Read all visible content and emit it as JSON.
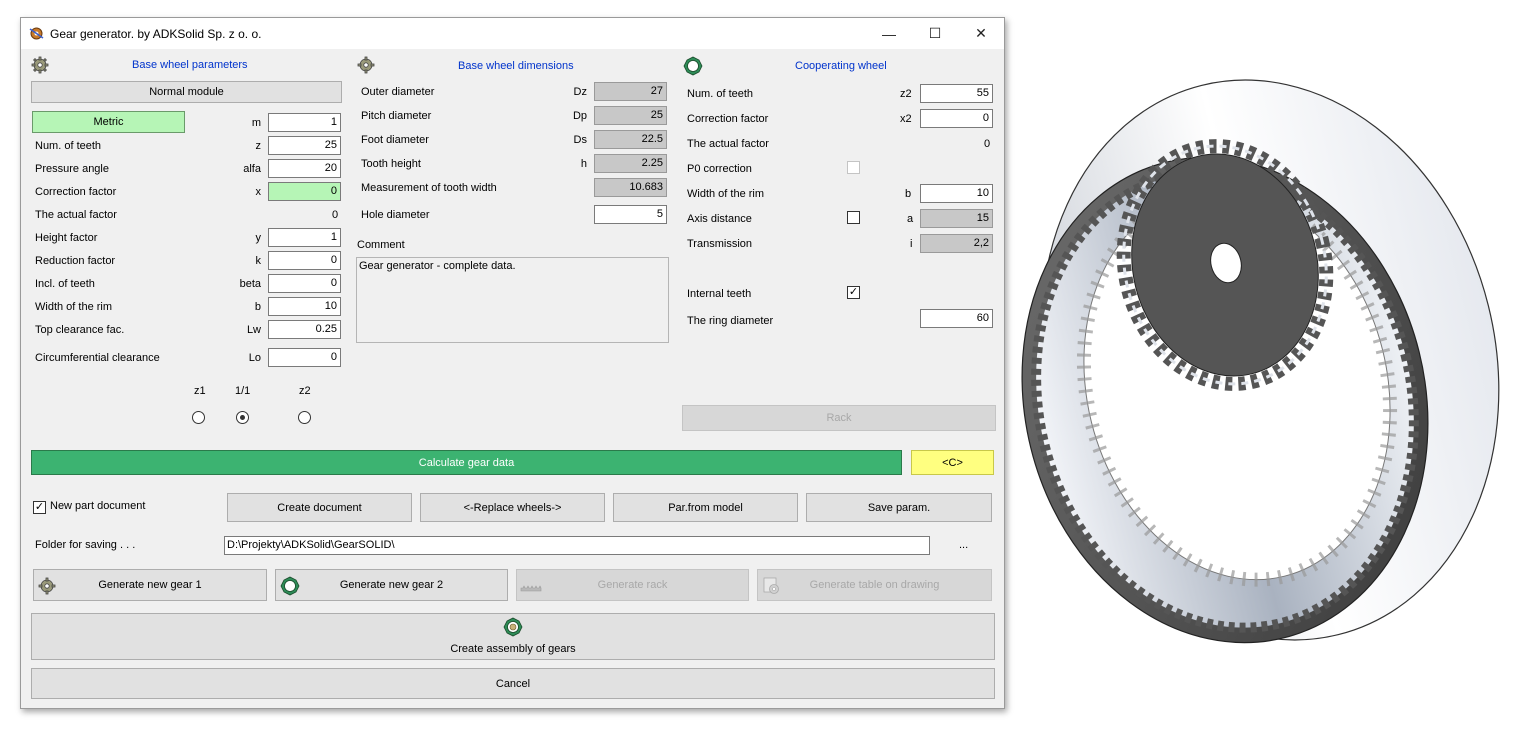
{
  "window": {
    "title": "Gear generator. by  ADKSolid Sp. z o. o.",
    "controls": {
      "minimize": "—",
      "maximize": "☐",
      "close": "✕"
    }
  },
  "base_params": {
    "header": "Base wheel parameters",
    "module_button": "Normal module",
    "metric_button": "Metric",
    "rows": [
      {
        "label": "",
        "symbol": "m",
        "value": "1"
      },
      {
        "label": "Num. of teeth",
        "symbol": "z",
        "value": "25"
      },
      {
        "label": "Pressure angle",
        "symbol": "alfa",
        "value": "20"
      },
      {
        "label": "Correction factor",
        "symbol": "x",
        "value": "0"
      },
      {
        "label": "The actual factor",
        "symbol": "",
        "value": "0"
      },
      {
        "label": "Height factor",
        "symbol": "y",
        "value": "1"
      },
      {
        "label": "Reduction factor",
        "symbol": "k",
        "value": "0"
      },
      {
        "label": "Incl. of teeth",
        "symbol": "beta",
        "value": "0"
      },
      {
        "label": "Width of the rim",
        "symbol": "b",
        "value": "10"
      },
      {
        "label": "Top clearance fac.",
        "symbol": "Lw",
        "value": "0.25"
      },
      {
        "label": "Circumferential clearance",
        "symbol": "Lo",
        "value": "0"
      }
    ],
    "ratio_options": [
      {
        "label": "z1",
        "selected": false
      },
      {
        "label": "1/1",
        "selected": true
      },
      {
        "label": "z2",
        "selected": false
      }
    ]
  },
  "dimensions": {
    "header": "Base wheel dimensions",
    "rows": [
      {
        "label": "Outer diameter",
        "symbol": "Dz",
        "value": "27"
      },
      {
        "label": "Pitch diameter",
        "symbol": "Dp",
        "value": "25"
      },
      {
        "label": "Foot diameter",
        "symbol": "Ds",
        "value": "22.5"
      },
      {
        "label": "Tooth height",
        "symbol": "h",
        "value": "2.25"
      },
      {
        "label": "Measurement of tooth width",
        "symbol": "",
        "value": "10.683"
      },
      {
        "label": "Hole diameter",
        "symbol": "",
        "value": "5"
      }
    ],
    "comment_label": "Comment",
    "comment_text": "Gear generator - complete data."
  },
  "coop": {
    "header": "Cooperating wheel",
    "teeth_label": "Num. of teeth",
    "teeth_symbol": "z2",
    "teeth_value": "55",
    "corr_label": "Correction factor",
    "corr_symbol": "x2",
    "corr_value": "0",
    "actual_label": "The actual factor",
    "actual_value": "0",
    "p0_label": "P0 correction",
    "rim_label": "Width of the rim",
    "rim_symbol": "b",
    "rim_value": "10",
    "axis_label": "Axis distance",
    "axis_symbol": "a",
    "axis_value": "15",
    "trans_label": "Transmission",
    "trans_symbol": "i",
    "trans_value": "2,2",
    "internal_label": "Internal teeth",
    "internal_checked": "✓",
    "ring_label": "The ring diameter",
    "ring_value": "60",
    "rack_button": "Rack"
  },
  "calc_button": "Calculate gear data",
  "c_button": "<C>",
  "new_part_label": "New part document",
  "new_part_checked": "✓",
  "doc_buttons": {
    "create": "Create document",
    "replace": "<-Replace wheels->",
    "par": "Par.from model",
    "save": "Save param."
  },
  "folder": {
    "label": "Folder for saving . . .",
    "path": "D:\\Projekty\\ADKSolid\\GearSOLID\\",
    "browse": "..."
  },
  "gen_buttons": {
    "gear1": "Generate new gear 1",
    "gear2": "Generate new gear 2",
    "rack": "Generate rack",
    "table": "Generate table on drawing"
  },
  "assembly_button": "Create assembly of gears",
  "cancel_button": "Cancel",
  "colors": {
    "calc_green": "#3cb371",
    "metric_green": "#b6f5b6",
    "c_yellow": "#ffff80",
    "header_blue": "#0033cc",
    "gear_fill": "#dfe3ea"
  }
}
